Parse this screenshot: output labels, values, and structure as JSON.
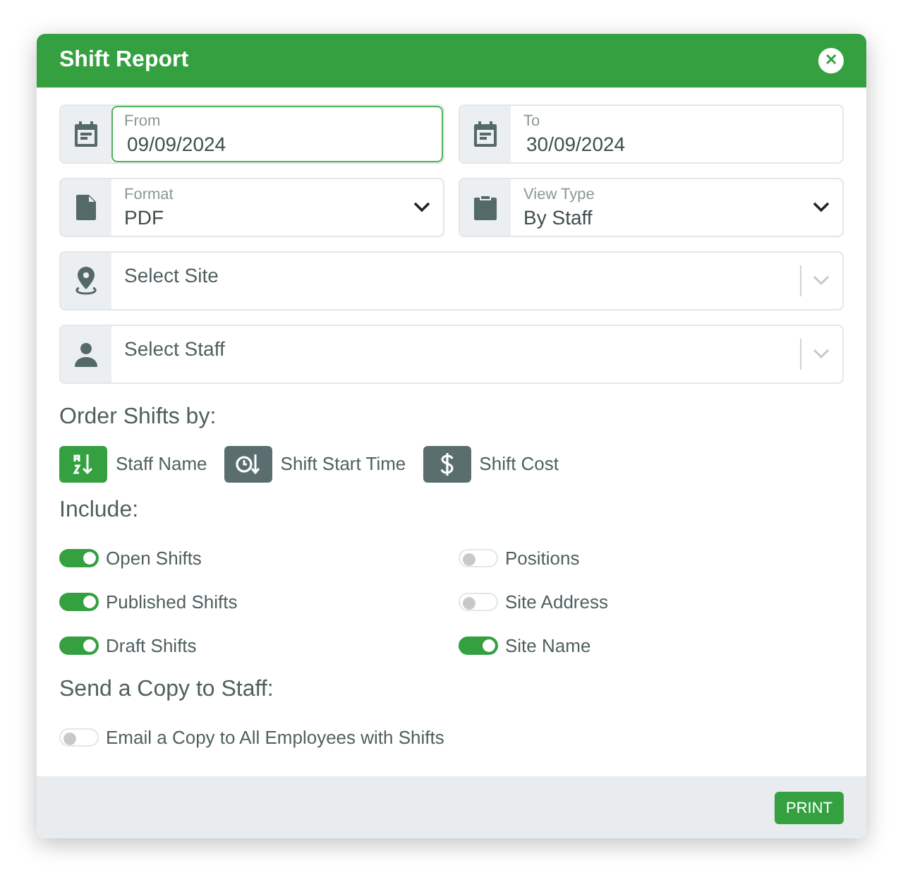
{
  "window": {
    "title": "Shift Report",
    "close": "✕"
  },
  "fields": [
    {
      "kind": "date",
      "label": "From",
      "value": "09/09/2024",
      "focused": true
    },
    {
      "kind": "date",
      "label": "To",
      "value": "30/09/2024",
      "focused": false
    },
    {
      "kind": "select",
      "label": "Format",
      "value": "PDF",
      "focused": false
    },
    {
      "kind": "select",
      "label": "View Type",
      "value": "By Staff",
      "focused": false
    },
    {
      "kind": "picker",
      "placeholder": "Select Site",
      "focused": false
    },
    {
      "kind": "picker",
      "placeholder": "Select Staff",
      "focused": false
    }
  ],
  "order": {
    "heading": "Order Shifts by:",
    "options": [
      {
        "label": "Staff Name",
        "selected": true
      },
      {
        "label": "Shift Start Time",
        "selected": false
      },
      {
        "label": "Shift Cost",
        "selected": false
      }
    ]
  },
  "include": {
    "heading": "Include:",
    "options": [
      {
        "label": "Open Shifts",
        "on": true
      },
      {
        "label": "Positions",
        "on": false
      },
      {
        "label": "Published Shifts",
        "on": true
      },
      {
        "label": "Site Address",
        "on": false
      },
      {
        "label": "Draft Shifts",
        "on": true
      },
      {
        "label": "Site Name",
        "on": true
      }
    ]
  },
  "send": {
    "heading": "Send a Copy to Staff:",
    "options": [
      {
        "label": "Email a Copy to All Employees with Shifts",
        "on": false
      }
    ]
  },
  "buttons": [
    "PRINT"
  ]
}
